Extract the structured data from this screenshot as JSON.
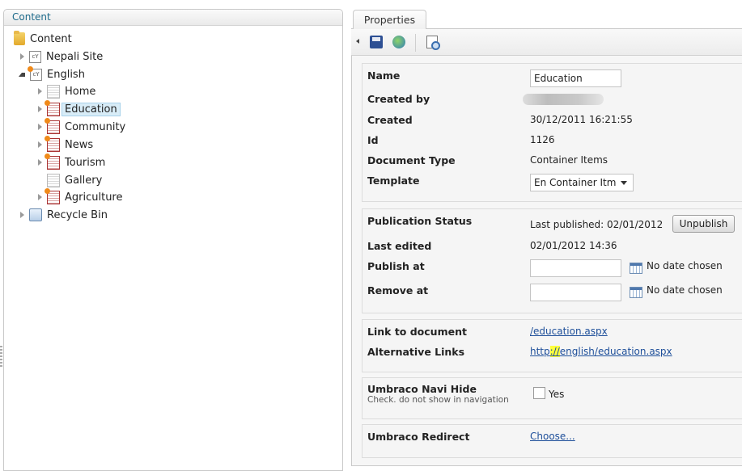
{
  "tree": {
    "header": "Content",
    "root": "Content",
    "items": [
      {
        "label": "Nepali Site"
      },
      {
        "label": "English"
      },
      {
        "label": "Home"
      },
      {
        "label": "Education"
      },
      {
        "label": "Community"
      },
      {
        "label": "News"
      },
      {
        "label": "Tourism"
      },
      {
        "label": "Gallery"
      },
      {
        "label": "Agriculture"
      },
      {
        "label": "Recycle Bin"
      }
    ]
  },
  "tab": {
    "label": "Properties"
  },
  "properties": {
    "name_label": "Name",
    "name_value": "Education",
    "created_by_label": "Created by",
    "created_label": "Created",
    "created_value": "30/12/2011 16:21:55",
    "id_label": "Id",
    "id_value": "1126",
    "doctype_label": "Document Type",
    "doctype_value": "Container Items",
    "template_label": "Template",
    "template_value": "En Container Itm"
  },
  "publication": {
    "status_label": "Publication Status",
    "last_published": "Last published: 02/01/2012",
    "unpublish_button": "Unpublish",
    "last_edited_label": "Last edited",
    "last_edited_value": "02/01/2012 14:36",
    "publish_at_label": "Publish at",
    "remove_at_label": "Remove at",
    "no_date": "No date chosen"
  },
  "links": {
    "link_label": "Link to document",
    "link_value": "/education.aspx",
    "alt_label": "Alternative Links",
    "alt_prefix": "http",
    "alt_highlight": "://",
    "alt_suffix": "english/education.aspx"
  },
  "navi": {
    "label": "Umbraco Navi Hide",
    "help": "Check. do not show in navigation",
    "checkbox_label": "Yes"
  },
  "redirect": {
    "label": "Umbraco Redirect",
    "choose": "Choose..."
  }
}
